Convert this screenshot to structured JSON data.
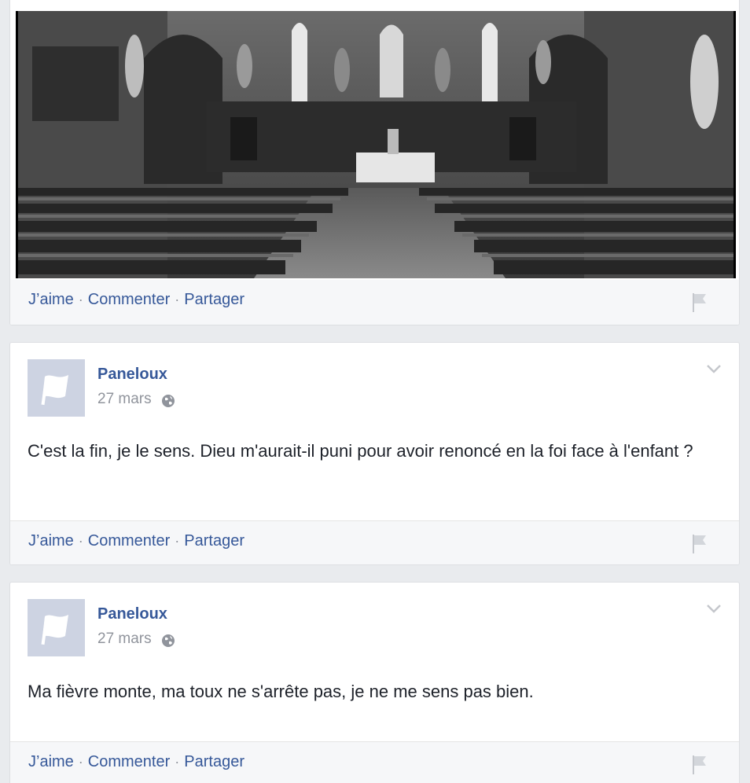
{
  "actions": {
    "like": "J’aime",
    "comment": "Commenter",
    "share": "Partager",
    "separator": "·"
  },
  "posts": [
    {
      "author": "Paneloux",
      "date": "27 mars",
      "text": "C'est la fin, je le sens. Dieu m'aurait-il puni  pour avoir renoncé en la foi face à l'enfant ?"
    },
    {
      "author": "Paneloux",
      "date": "27 mars",
      "text": "Ma fièvre monte, ma toux ne s'arrête pas, je ne me sens pas bien."
    }
  ],
  "colors": {
    "link": "#365899",
    "background": "#e9ebee",
    "action_bar": "#f6f7f9",
    "muted": "#90949c",
    "avatar_bg": "#cdd3e2"
  },
  "icons": {
    "flag": "flag-icon",
    "globe": "globe-icon",
    "chevron": "chevron-down-icon",
    "avatar": "page-flag-avatar"
  }
}
